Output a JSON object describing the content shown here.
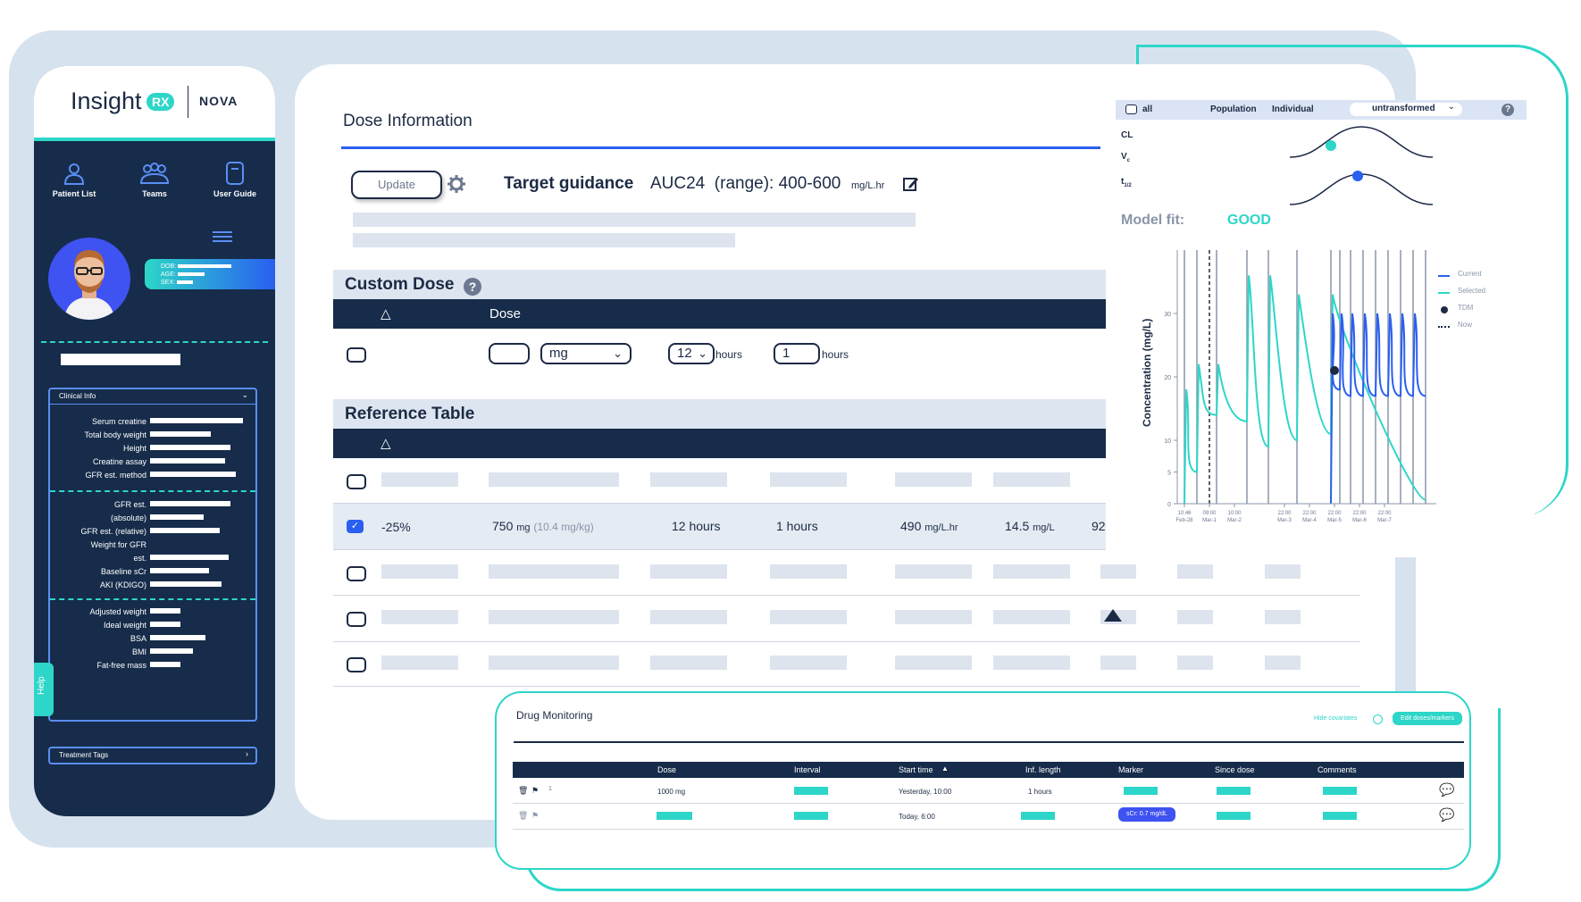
{
  "logo": {
    "brand": "Insight",
    "badge": "RX",
    "product": "NOVA"
  },
  "nav": [
    {
      "label": "Patient List",
      "icon": "user-icon"
    },
    {
      "label": "Teams",
      "icon": "team-icon"
    },
    {
      "label": "User Guide",
      "icon": "book-icon"
    }
  ],
  "patient": {
    "labels": [
      "DOB:",
      "AGE:",
      "SEX:"
    ]
  },
  "clinical": {
    "header": "Clinical Info",
    "group1": [
      "Serum creatine",
      "Total body weight",
      "Height",
      "Creatine assay",
      "GFR est. method"
    ],
    "group2": [
      "GFR est.",
      "(absolute)",
      "GFR est. (relative)",
      "Weight for GFR",
      "est.",
      "Baseline sCr",
      "AKI (KDIGO)"
    ],
    "group3": [
      "Adjusted weight",
      "Ideal weight",
      "BSA",
      "BMI",
      "Fat-free mass"
    ]
  },
  "treatment_tags": "Treatment Tags",
  "help": "Help",
  "dose": {
    "title": "Dose Information",
    "update_label": "Update",
    "target_label": "Target guidance",
    "target_value": "AUC24  (range): 400-600",
    "target_unit": "mg/L.hr",
    "custom_title": "Custom Dose",
    "custom_col_dose": "Dose",
    "custom_delta": "△",
    "unit_value": "mg",
    "interval_value": "12",
    "interval_unit": "hours",
    "infusion_value": "1",
    "infusion_unit": "hours",
    "ref_title": "Reference Table",
    "ref_delta": "△",
    "selected_row": {
      "delta": "-25%",
      "dose": "750",
      "dose_unit": "mg",
      "dose_per_kg": "(10.4 mg/kg)",
      "interval": "12 hours",
      "infusion": "1 hours",
      "auc": "490",
      "auc_unit": "mg/L.hr",
      "trough": "14.5",
      "trough_unit": "mg/L",
      "extra": "92"
    }
  },
  "chart": {
    "toolbar": {
      "all": "all",
      "population": "Population",
      "individual": "Individual",
      "select_value": "untransformed",
      "help": "?"
    },
    "params": [
      "CL",
      "V",
      "t"
    ],
    "param_subscripts": [
      "",
      "c",
      "1/2"
    ],
    "model_fit_label": "Model fit:",
    "model_fit_value": "GOOD",
    "accent": "#2dd6c8",
    "selected_color": "#2a5ff0"
  },
  "chart_data": {
    "type": "line",
    "ylabel": "Concentration (mg/L)",
    "y_ticks": [
      0,
      5,
      10,
      20,
      30
    ],
    "x_ticks": [
      {
        "top": "10:46",
        "bottom": "Feb-28"
      },
      {
        "top": "09:00",
        "bottom": "Mar-1"
      },
      {
        "top": "10:00",
        "bottom": "Mar-2"
      },
      {
        "top": "22:00",
        "bottom": "Mar-3"
      },
      {
        "top": "22:00",
        "bottom": "Mar-4"
      },
      {
        "top": "22:00",
        "bottom": "Mar-5"
      },
      {
        "top": "22:00",
        "bottom": "Mar-6"
      },
      {
        "top": "22:00",
        "bottom": "Mar-7"
      }
    ],
    "legend": [
      {
        "name": "Current",
        "color": "#2a5ff0"
      },
      {
        "name": "Selected",
        "color": "#2dd6c8"
      },
      {
        "name": "TDM",
        "color": "#1c2a44"
      },
      {
        "name": "Now",
        "color": "#1c2a44"
      }
    ],
    "tdm_value": 21
  },
  "monitoring": {
    "title": "Drug Monitoring",
    "hide_link": "Hide covariates",
    "edit_button": "Edit doses/markers",
    "columns": [
      "Dose",
      "Interval",
      "Start time",
      "Inf. length",
      "Marker",
      "Since dose",
      "Comments"
    ],
    "row1": {
      "index": "1",
      "dose": "1000 mg",
      "start": "Yesterday, 10:00",
      "inf": "1 hours"
    },
    "row2": {
      "start": "Today, 6:00",
      "marker": "sCr: 0.7 mg/dL"
    }
  }
}
